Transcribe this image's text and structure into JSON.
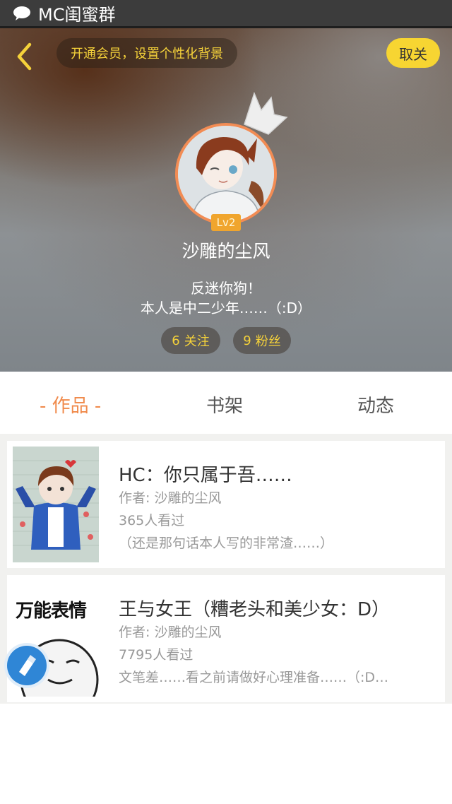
{
  "status_bar": {
    "title": "MC闺蜜群"
  },
  "header": {
    "vip_prompt": "开通会员，设置个性化背景",
    "unfollow_label": "取关",
    "level": "Lv2",
    "username": "沙雕的尘风",
    "bio_line1": "反迷你狗！",
    "bio_line2": "本人是中二少年……（:D）",
    "following_count": "6",
    "following_label": "关注",
    "fans_count": "9",
    "fans_label": "粉丝"
  },
  "tabs": [
    {
      "label": "- 作品 -",
      "active": true
    },
    {
      "label": "书架",
      "active": false
    },
    {
      "label": "动态",
      "active": false
    }
  ],
  "works": [
    {
      "title": "HC：你只属于吾……",
      "author": "作者: 沙雕的尘风",
      "views": "365人看过",
      "description": "（还是那句话本人写的非常渣……）"
    },
    {
      "title": "王与女王（糟老头和美少女：D）",
      "author": "作者: 沙雕的尘风",
      "views": "7795人看过",
      "description": "文笔差……看之前请做好心理准备……（:D…",
      "thumb_text": "万能表情"
    }
  ],
  "colors": {
    "accent_yellow": "#f5d23a",
    "active_tab": "#f08a4b",
    "avatar_ring": "#f28c54",
    "float_button": "#2f86d6"
  }
}
